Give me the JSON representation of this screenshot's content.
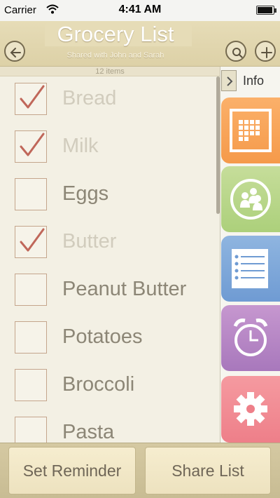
{
  "status": {
    "carrier": "Carrier",
    "time": "4:41 AM",
    "battery": 0.95
  },
  "header": {
    "title": "Grocery List",
    "subtitle": "Shared with John and Sarah"
  },
  "count_label": "12 items",
  "items": [
    {
      "label": "Bread",
      "checked": true
    },
    {
      "label": "Milk",
      "checked": true
    },
    {
      "label": "Eggs",
      "checked": false
    },
    {
      "label": "Butter",
      "checked": true
    },
    {
      "label": "Peanut Butter",
      "checked": false
    },
    {
      "label": "Potatoes",
      "checked": false
    },
    {
      "label": "Broccoli",
      "checked": false
    },
    {
      "label": "Pasta",
      "checked": false
    }
  ],
  "side_panel": {
    "info_label": "Info",
    "tiles": [
      {
        "icon": "calendar-icon",
        "color": "#f59a4a"
      },
      {
        "icon": "people-icon",
        "color": "#acd07b"
      },
      {
        "icon": "list-icon",
        "color": "#6f9bd3"
      },
      {
        "icon": "alarm-clock-icon",
        "color": "#a878bc"
      },
      {
        "icon": "gear-icon",
        "color": "#ee7f89"
      }
    ]
  },
  "actions": {
    "reminder_label": "Set Reminder",
    "share_label": "Share List"
  },
  "colors": {
    "header": "#e6dcb7",
    "check": "#c0675a",
    "background": "#f3f0e4"
  }
}
